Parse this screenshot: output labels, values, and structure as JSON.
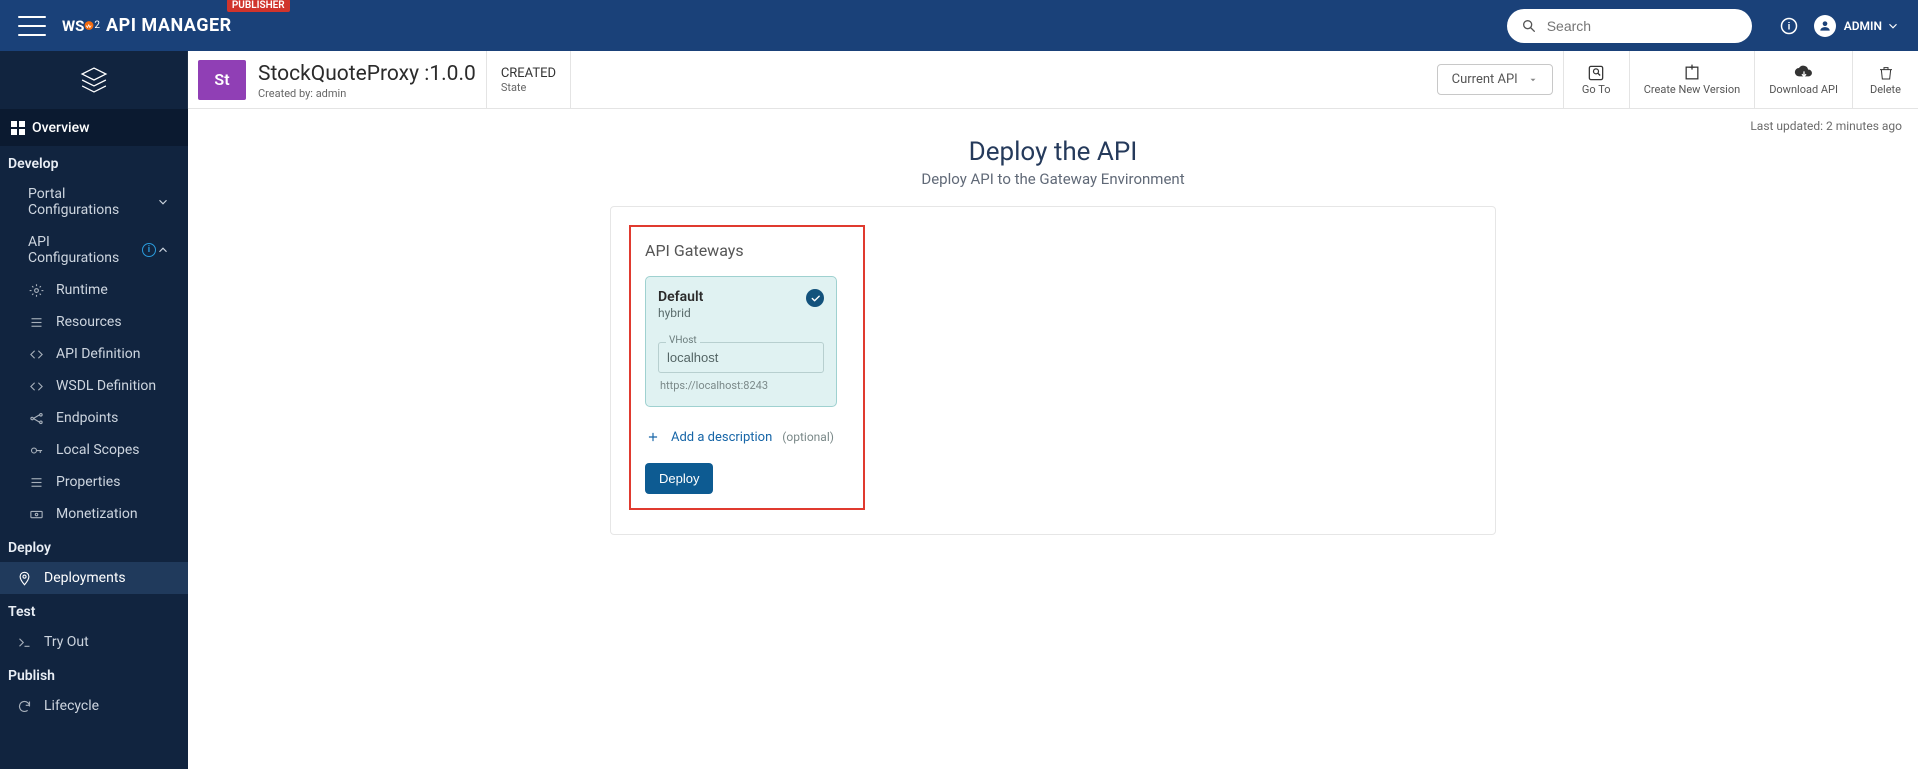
{
  "colors": {
    "primary": "#1a4179",
    "sidebar": "#11243f",
    "accent": "#0d5b92",
    "danger": "#e03a2f",
    "thumb": "#903fb5"
  },
  "top": {
    "badge": "PUBLISHER",
    "brand_prefix": "WS",
    "brand_o": "O",
    "brand_two": "2",
    "brand_title": "API MANAGER",
    "search_placeholder": "Search",
    "user_label": "ADMIN"
  },
  "sidebar": {
    "overview": "Overview",
    "sections": {
      "develop": "Develop",
      "portal_conf": "Portal Configurations",
      "api_conf": "API Configurations",
      "deploy": "Deploy",
      "test": "Test",
      "publish": "Publish"
    },
    "api_conf_items": [
      {
        "label": "Runtime"
      },
      {
        "label": "Resources"
      },
      {
        "label": "API Definition"
      },
      {
        "label": "WSDL Definition"
      },
      {
        "label": "Endpoints"
      },
      {
        "label": "Local Scopes"
      },
      {
        "label": "Properties"
      },
      {
        "label": "Monetization"
      }
    ],
    "deploy_items": [
      {
        "label": "Deployments"
      }
    ],
    "test_items": [
      {
        "label": "Try Out"
      }
    ],
    "publish_items": [
      {
        "label": "Lifecycle"
      }
    ]
  },
  "api": {
    "thumb_text": "St",
    "name": "StockQuoteProxy :1.0.0",
    "created_by_label": "Created by: ",
    "created_by": "admin",
    "state": "CREATED",
    "state_label": "State",
    "current_api": "Current API",
    "tools": {
      "goto": "Go To",
      "create_new": "Create New Version",
      "download": "Download API",
      "delete": "Delete"
    }
  },
  "main": {
    "last_updated": "Last updated: 2 minutes ago",
    "title": "Deploy the API",
    "subtitle": "Deploy API to the Gateway Environment",
    "gateways_title": "API Gateways",
    "gateway": {
      "name": "Default",
      "type": "hybrid",
      "vhost_label": "VHost",
      "vhost_value": "localhost",
      "vhost_url": "https://localhost:8243"
    },
    "add_desc": "Add a description",
    "optional": "(optional)",
    "deploy_btn": "Deploy"
  }
}
